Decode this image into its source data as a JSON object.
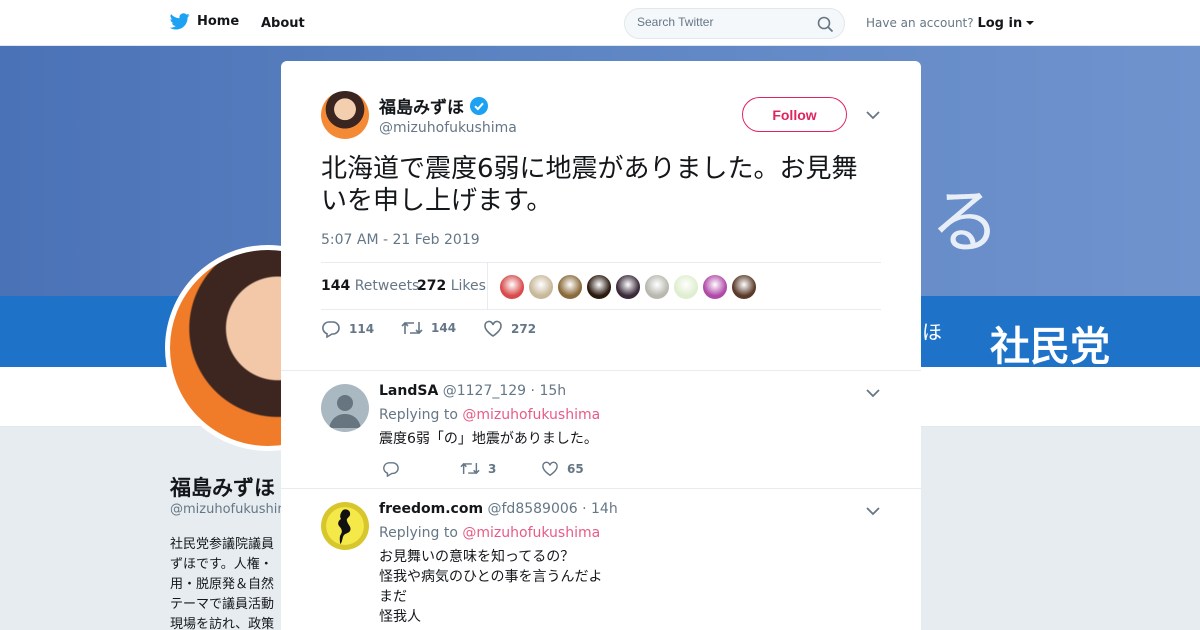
{
  "topbar": {
    "home_label": "Home",
    "about_label": "About",
    "search_placeholder": "Search Twitter",
    "account_prompt": "Have an account?",
    "login_label": "Log in"
  },
  "profile": {
    "name": "福島みずほ",
    "handle": "@mizuhofukushima",
    "bio": "社民党参議院議員ずほです。人権・用・脱原発＆自然テーマで議員活動現場を訪れ、政策",
    "banner_text": "る",
    "banner_party": "社民党",
    "banner_small": "ほ"
  },
  "tweet": {
    "author_name": "福島みずほ",
    "author_handle": "@mizuhofukushima",
    "follow_label": "Follow",
    "text": "北海道で震度6弱に地震がありました。お見舞いを申し上げます。",
    "timestamp": "5:07 AM - 21 Feb 2019",
    "retweets_count": "144",
    "retweets_label": "Retweets",
    "likes_count": "272",
    "likes_label": "Likes",
    "reply_count": "114",
    "retweet_action_count": "144",
    "like_action_count": "272",
    "liker_colors": [
      "#d84b4b",
      "#c8b89a",
      "#8a6a3a",
      "#2a1a10",
      "#3a2a3a",
      "#b8b8b0",
      "#dfeecf",
      "#b04aa8",
      "#5a3a2a"
    ]
  },
  "replies": [
    {
      "name": "LandSA",
      "handle": "@1127_129",
      "time": "· 15h",
      "replying_prefix": "Replying to",
      "replying_to": "@mizuhofukushima",
      "body": "震度6弱「の」地震がありました。",
      "reply_count": "",
      "retweet_count": "3",
      "like_count": "65"
    },
    {
      "name": "freedom.com",
      "handle": "@fd8589006",
      "time": "· 14h",
      "replying_prefix": "Replying to",
      "replying_to": "@mizuhofukushima",
      "body_lines": [
        "お見舞いの意味を知ってるの？",
        "怪我や病気のひとの事を言うんだよ",
        "まだ",
        "怪我人"
      ]
    }
  ],
  "colors": {
    "accent": "#e0245e",
    "twitter_blue": "#1da1f2",
    "muted": "#657786"
  }
}
